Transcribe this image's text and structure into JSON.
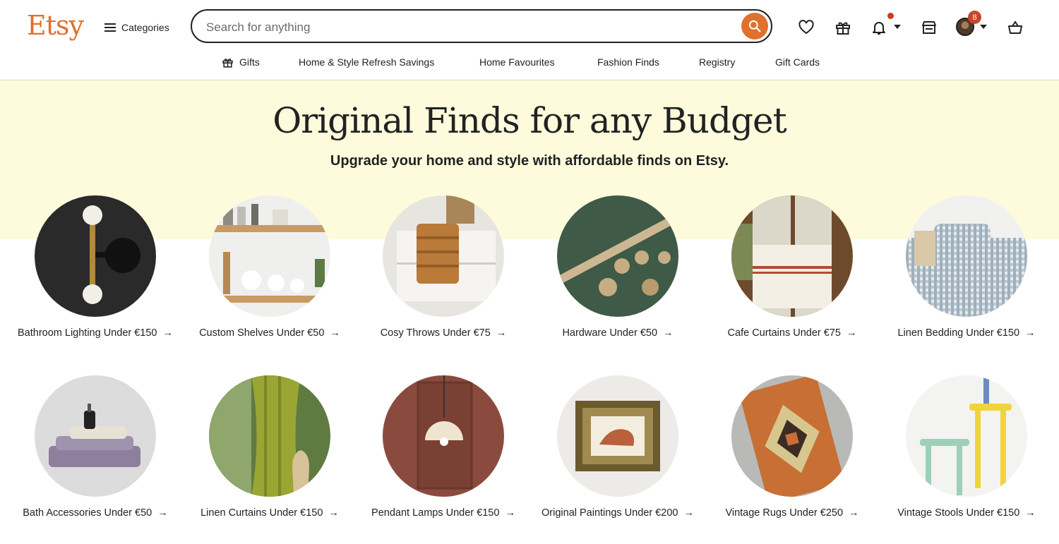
{
  "header": {
    "logo": "Etsy",
    "categories_label": "Categories",
    "search_placeholder": "Search for anything",
    "cart_badge": "8"
  },
  "nav": [
    {
      "label": "Gifts"
    },
    {
      "label": "Home & Style Refresh Savings"
    },
    {
      "label": "Home Favourites"
    },
    {
      "label": "Fashion Finds"
    },
    {
      "label": "Registry"
    },
    {
      "label": "Gift Cards"
    }
  ],
  "hero": {
    "title": "Original Finds for any Budget",
    "subtitle": "Upgrade your home and style with affordable finds on Etsy."
  },
  "cards": [
    {
      "label": "Bathroom Lighting Under €150",
      "arrow": "→"
    },
    {
      "label": "Custom Shelves Under €50",
      "arrow": "→"
    },
    {
      "label": "Cosy Throws Under €75",
      "arrow": "→"
    },
    {
      "label": "Hardware Under €50",
      "arrow": "→"
    },
    {
      "label": "Cafe Curtains Under €75",
      "arrow": "→"
    },
    {
      "label": "Linen Bedding Under €150",
      "arrow": "→"
    },
    {
      "label": "Bath Accessories Under €50",
      "arrow": "→"
    },
    {
      "label": "Linen Curtains Under €150",
      "arrow": "→"
    },
    {
      "label": "Pendant Lamps Under €150",
      "arrow": "→"
    },
    {
      "label": "Original Paintings Under €200",
      "arrow": "→"
    },
    {
      "label": "Vintage Rugs Under €250",
      "arrow": "→"
    },
    {
      "label": "Vintage Stools Under €150",
      "arrow": "→"
    }
  ]
}
